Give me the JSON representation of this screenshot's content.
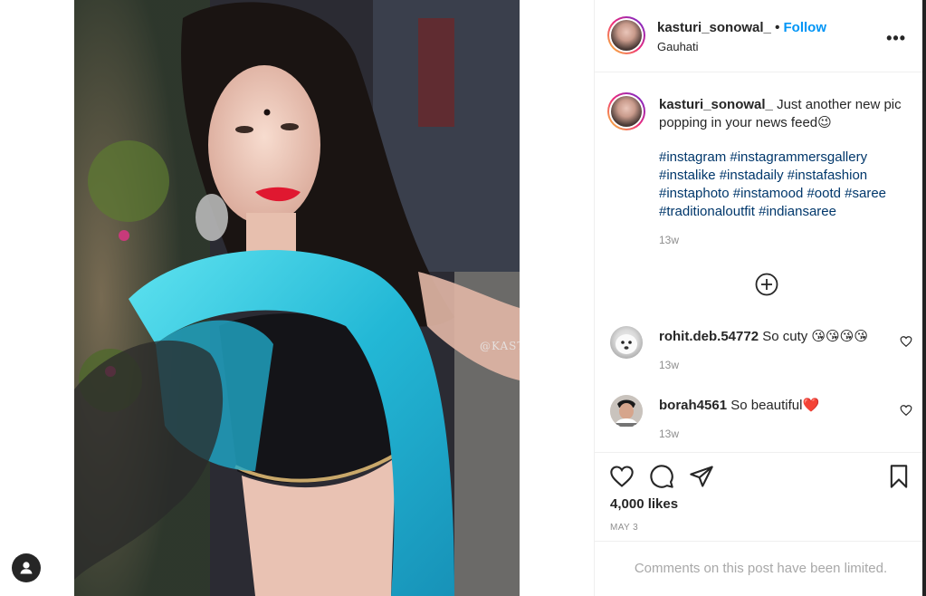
{
  "post": {
    "username": "kasturi_sonowal_",
    "separator": "•",
    "follow_label": "Follow",
    "location": "Gauhati",
    "more_label": "•••",
    "watermark": "@KASTURISONOWAL",
    "caption_text": "Just another new pic popping in your news feed😉",
    "hashtags": "#instagram #instagrammersgallery #instalike #instadaily #instafashion #instaphoto #instamood #ootd #saree #traditionaloutfit #indiansaree",
    "caption_time": "13w",
    "likes": "4,000 likes",
    "date": "MAY 3",
    "comments_limited": "Comments on this post have been limited."
  },
  "comments": [
    {
      "username": "rohit.deb.54772",
      "text": "So cuty 😘😘😘😘",
      "time": "13w"
    },
    {
      "username": "borah4561",
      "text": "So beautiful❤️",
      "time": "13w"
    }
  ],
  "icons": {
    "load_more": "plus-circle-icon",
    "like": "heart-icon",
    "comment": "comment-icon",
    "share": "send-icon",
    "save": "bookmark-icon"
  },
  "colors": {
    "accent": "#0095f6",
    "hashtag": "#00376b",
    "muted": "#8e8e8e"
  }
}
